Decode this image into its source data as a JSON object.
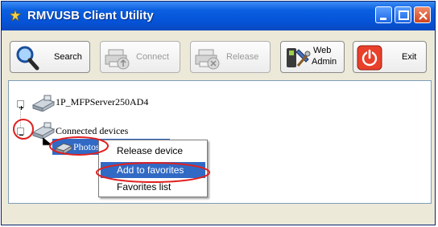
{
  "window": {
    "title": "RMVUSB Client Utility",
    "titlebar_color": "#0553d8"
  },
  "toolbar": {
    "search_label": "Search",
    "connect_label": "Connect",
    "release_label": "Release",
    "webadmin_label_line1": "Web",
    "webadmin_label_line2": "Admin",
    "exit_label": "Exit"
  },
  "tree": {
    "server_label": "1P_MFPServer250AD4",
    "connected_label": "Connected devices",
    "device_label": "Photos"
  },
  "context_menu": {
    "items": [
      {
        "label": "Release device",
        "selected": false
      },
      {
        "label": "Add to favorites",
        "selected": true
      },
      {
        "label": "Favorites list",
        "selected": false
      }
    ],
    "highlight_color": "#316ac5"
  },
  "annotations": {
    "circle_color": "#e02020"
  },
  "icons": {
    "search": "magnifier-icon",
    "connect": "printer-connect-icon",
    "release": "printer-release-icon",
    "webadmin": "tools-icon",
    "exit": "power-icon"
  }
}
